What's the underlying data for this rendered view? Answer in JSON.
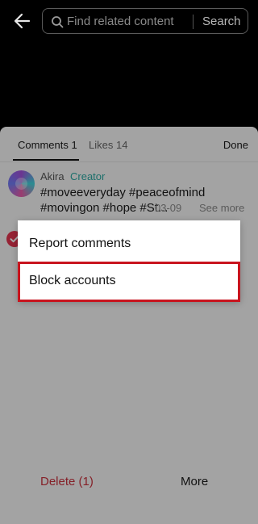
{
  "header": {
    "search_placeholder": "Find related content",
    "search_button": "Search"
  },
  "tabs": {
    "comments": "Comments 1",
    "likes": "Likes 14",
    "done": "Done"
  },
  "comment": {
    "author": "Akira",
    "badge": "Creator",
    "line1": "#moveeveryday #peaceofmind",
    "line2": "#movingon #hope #St...",
    "date": "03-09",
    "see_more": "See more"
  },
  "menu": {
    "report": "Report comments",
    "block": "Block accounts"
  },
  "bottom": {
    "delete": "Delete (1)",
    "more": "More"
  },
  "colors": {
    "accent_red": "#c8141e",
    "creator_teal": "#2aa6a0",
    "selection_red": "#e0344e"
  }
}
